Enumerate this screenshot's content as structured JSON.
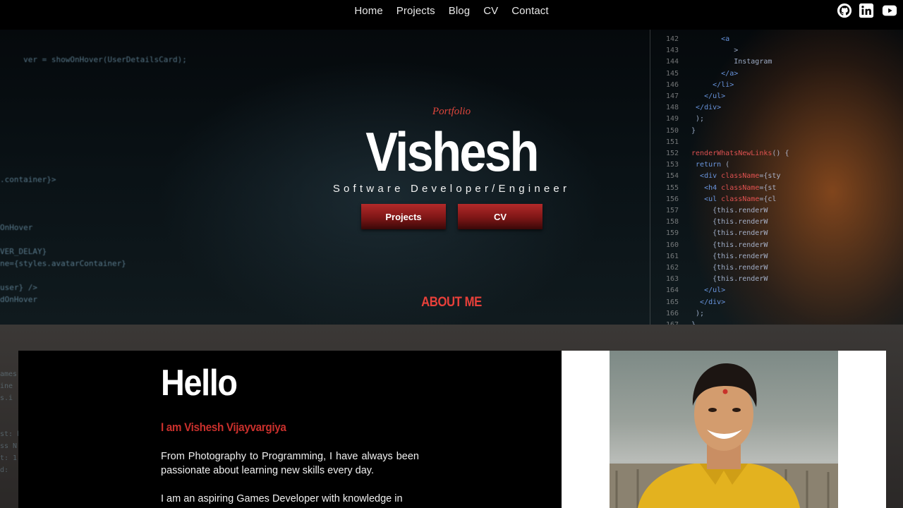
{
  "nav": {
    "items": [
      "Home",
      "Projects",
      "Blog",
      "CV",
      "Contact"
    ]
  },
  "social": {
    "icons": [
      "github-icon",
      "linkedin-icon",
      "youtube-icon"
    ]
  },
  "hero": {
    "kicker": "Portfolio",
    "name": "Vishesh",
    "role": "Software Developer/Engineer",
    "buttons": {
      "projects": "Projects",
      "cv": "CV"
    },
    "about_link": "ABOUT ME"
  },
  "about": {
    "greeting": "Hello",
    "intro": "I am Vishesh Vijayvargiya",
    "paragraph1": "From Photography to Programming, I have always been passionate about learning new skills every day.",
    "paragraph2": "I am an aspiring Games Developer with knowledge in"
  },
  "colors": {
    "accent_red": "#e0463c",
    "button_red": "#a82424",
    "background": "#000000"
  }
}
